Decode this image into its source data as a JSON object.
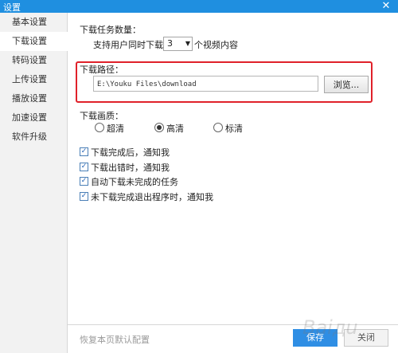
{
  "window": {
    "title": "设置",
    "close_glyph": "✕"
  },
  "sidebar": {
    "items": [
      {
        "label": "基本设置",
        "active": false
      },
      {
        "label": "下载设置",
        "active": true
      },
      {
        "label": "转码设置",
        "active": false
      },
      {
        "label": "上传设置",
        "active": false
      },
      {
        "label": "播放设置",
        "active": false
      },
      {
        "label": "加速设置",
        "active": false
      },
      {
        "label": "软件升级",
        "active": false
      }
    ]
  },
  "download_tasks": {
    "heading": "下载任务数量：",
    "prefix": "支持用户同时下载",
    "selected_value": "3",
    "suffix": "个视频内容"
  },
  "download_path": {
    "heading": "下载路径：",
    "value": "E:\\Youku Files\\download",
    "browse_label": "浏览..."
  },
  "quality": {
    "heading": "下载画质：",
    "options": [
      {
        "label": "超清",
        "checked": false
      },
      {
        "label": "高清",
        "checked": true
      },
      {
        "label": "标清",
        "checked": false
      }
    ]
  },
  "notifications": [
    {
      "label": "下载完成后，通知我",
      "checked": true
    },
    {
      "label": "下载出错时，通知我",
      "checked": true
    },
    {
      "label": "自动下载未完成的任务",
      "checked": true
    },
    {
      "label": "未下载完成退出程序时，通知我",
      "checked": true
    }
  ],
  "footer": {
    "reset_label": "恢复本页默认配置",
    "ok_label": "保存",
    "close_label": "关闭"
  },
  "watermark_text": "Baiдu"
}
